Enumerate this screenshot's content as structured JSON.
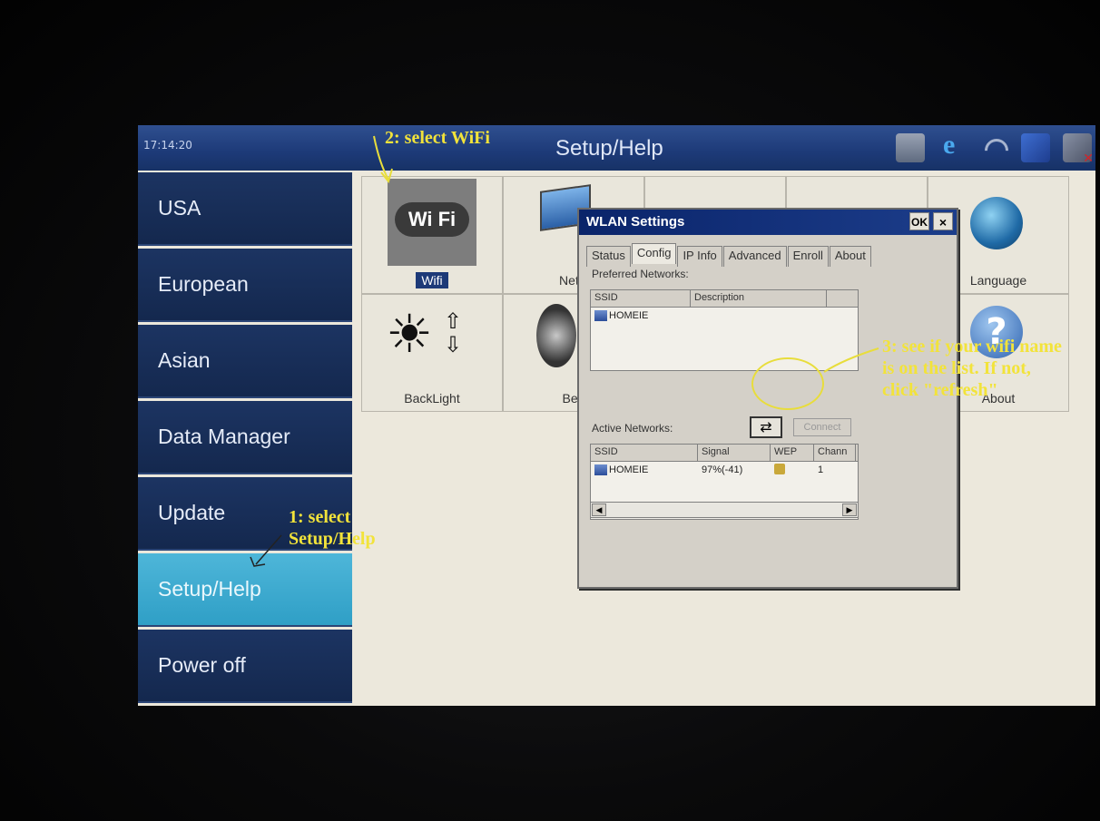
{
  "statusbar": {
    "clock": "17:14:20",
    "title": "Setup/Help",
    "tray_icons": [
      "folder-icon",
      "internet-explorer-icon",
      "wifi-signal-icon",
      "network-icon",
      "usb-disconnected-icon"
    ]
  },
  "menu": {
    "items": [
      {
        "label": "USA"
      },
      {
        "label": "European"
      },
      {
        "label": "Asian"
      },
      {
        "label": "Data Manager"
      },
      {
        "label": "Update"
      },
      {
        "label": "Setup/Help",
        "active": true
      },
      {
        "label": "Power off"
      }
    ]
  },
  "tiles": {
    "wifi": {
      "label": "Wifi",
      "logo_text": "Wi Fi"
    },
    "network": {
      "label": "Netw"
    },
    "language": {
      "label": "Language"
    },
    "backlight": {
      "label": "BackLight"
    },
    "beep": {
      "label": "Bee"
    },
    "about": {
      "label": "About"
    }
  },
  "wlan_dialog": {
    "title": "WLAN Settings",
    "ok": "OK",
    "close": "×",
    "tabs": [
      "Status",
      "Config",
      "IP Info",
      "Advanced",
      "Enroll",
      "About"
    ],
    "active_tab": "Config",
    "preferred": {
      "label": "Preferred Networks:",
      "columns": [
        "SSID",
        "Description"
      ],
      "rows": [
        {
          "ssid": "HOMEIE",
          "description": ""
        }
      ]
    },
    "active": {
      "label": "Active Networks:",
      "connect_label": "Connect",
      "columns": [
        "SSID",
        "Signal",
        "WEP",
        "Chann"
      ],
      "rows": [
        {
          "ssid": "HOMEIE",
          "signal": "97%(-41)",
          "wep": "lock-icon",
          "channel": "1"
        }
      ]
    }
  },
  "annotations": {
    "step1": "1: select Setup/Help",
    "step2": "2: select WiFi",
    "step3": "3: see if your wifi name is on the list. If not, click \"refresh\""
  }
}
